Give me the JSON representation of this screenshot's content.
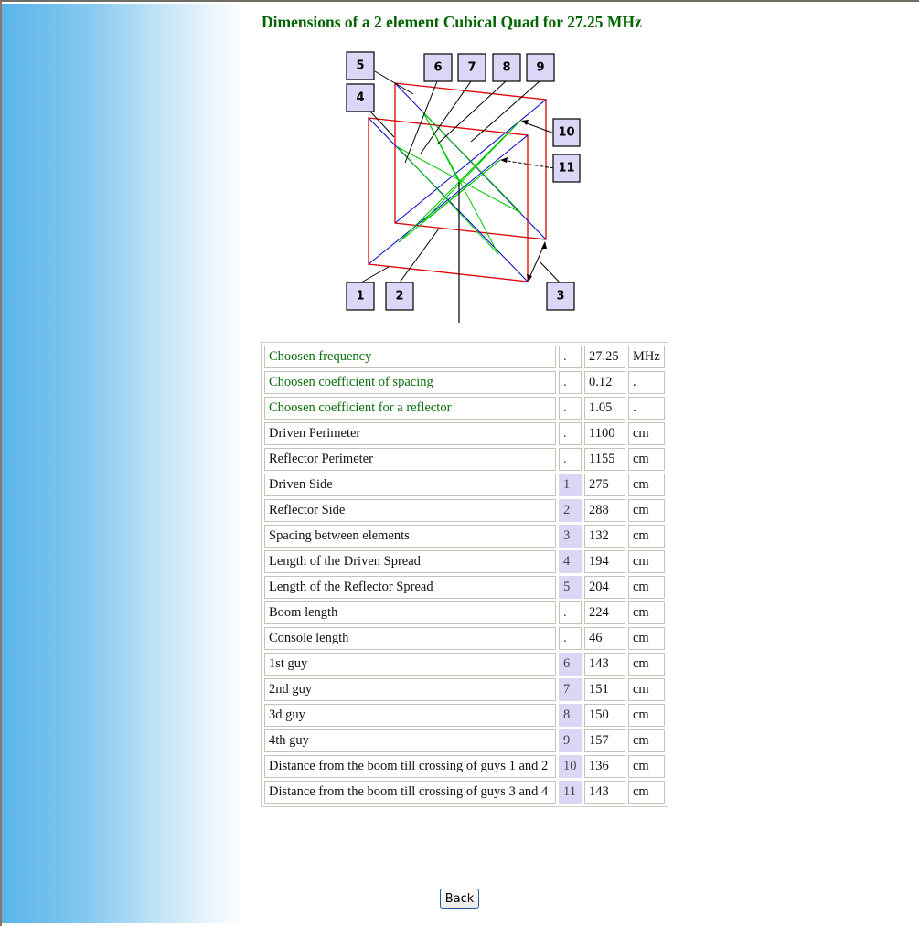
{
  "page": {
    "title": "Dimensions of a 2 element Cubical Quad for 27.25 MHz",
    "back_label": "Back"
  },
  "diagram": {
    "labels": [
      "1",
      "2",
      "3",
      "4",
      "5",
      "6",
      "7",
      "8",
      "9",
      "10",
      "11"
    ],
    "colors": {
      "frame": "#e00000",
      "diagonal": "#0000cc",
      "guy": "#00c800",
      "leader": "#000000",
      "label_fill": "#dcd6f7"
    }
  },
  "table": {
    "rows": [
      {
        "name": "Choosen frequency",
        "ref": ".",
        "value": "27.25",
        "unit": "MHz",
        "input": true
      },
      {
        "name": "Choosen coefficient of spacing",
        "ref": ".",
        "value": "0.12",
        "unit": ".",
        "input": true
      },
      {
        "name": "Choosen coefficient for a reflector",
        "ref": ".",
        "value": "1.05",
        "unit": ".",
        "input": true
      },
      {
        "name": "Driven Perimeter",
        "ref": ".",
        "value": "1100",
        "unit": "cm"
      },
      {
        "name": "Reflector Perimeter",
        "ref": ".",
        "value": "1155",
        "unit": "cm"
      },
      {
        "name": "Driven Side",
        "ref": "1",
        "value": "275",
        "unit": "cm"
      },
      {
        "name": "Reflector Side",
        "ref": "2",
        "value": "288",
        "unit": "cm"
      },
      {
        "name": "Spacing between elements",
        "ref": "3",
        "value": "132",
        "unit": "cm"
      },
      {
        "name": "Length of the Driven Spread",
        "ref": "4",
        "value": "194",
        "unit": "cm"
      },
      {
        "name": "Length of the Reflector Spread",
        "ref": "5",
        "value": "204",
        "unit": "cm"
      },
      {
        "name": "Boom length",
        "ref": ".",
        "value": "224",
        "unit": "cm"
      },
      {
        "name": "Console length",
        "ref": ".",
        "value": "46",
        "unit": "cm"
      },
      {
        "name": "1st guy",
        "ref": "6",
        "value": "143",
        "unit": "cm"
      },
      {
        "name": "2nd guy",
        "ref": "7",
        "value": "151",
        "unit": "cm"
      },
      {
        "name": "3d guy",
        "ref": "8",
        "value": "150",
        "unit": "cm"
      },
      {
        "name": "4th guy",
        "ref": "9",
        "value": "157",
        "unit": "cm"
      },
      {
        "name": "Distance from the boom till crossing of guys 1 and 2",
        "ref": "10",
        "value": "136",
        "unit": "cm"
      },
      {
        "name": "Distance from the boom till crossing of guys 3 and 4",
        "ref": "11",
        "value": "143",
        "unit": "cm"
      }
    ]
  }
}
